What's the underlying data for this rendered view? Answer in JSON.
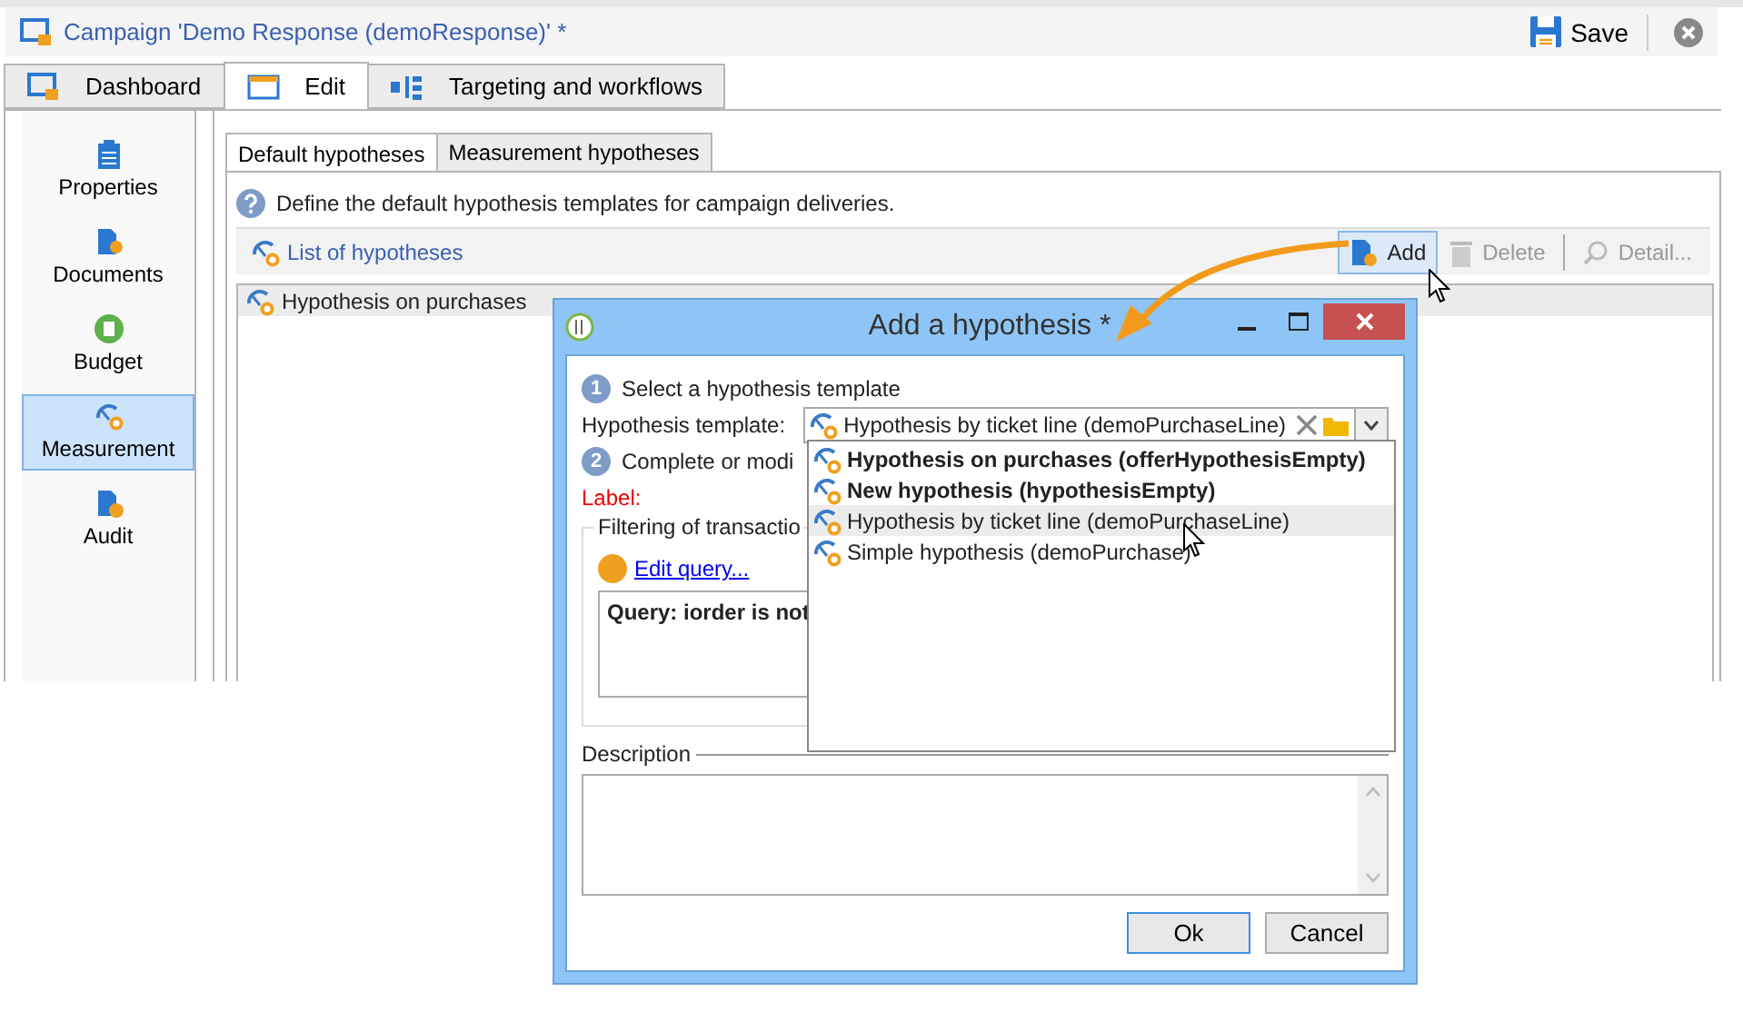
{
  "window": {
    "title": "Campaign 'Demo Response (demoResponse)' *",
    "save": "Save"
  },
  "tabs": [
    {
      "label": "Dashboard",
      "kind": "dashboard",
      "selected": false
    },
    {
      "label": "Edit",
      "kind": "edit",
      "selected": true
    },
    {
      "label": "Targeting and workflows",
      "kind": "workflow",
      "selected": false
    }
  ],
  "sidebar": {
    "items": [
      {
        "label": "Properties",
        "kind": "clipboard",
        "selected": false
      },
      {
        "label": "Documents",
        "kind": "document",
        "selected": false
      },
      {
        "label": "Budget",
        "kind": "budget",
        "selected": false
      },
      {
        "label": "Measurement",
        "kind": "gauge",
        "selected": true
      },
      {
        "label": "Audit",
        "kind": "audit",
        "selected": false
      }
    ]
  },
  "subtabs": [
    {
      "label": "Default hypotheses",
      "selected": true
    },
    {
      "label": "Measurement hypotheses",
      "selected": false
    }
  ],
  "info": "Define the default hypothesis templates for campaign deliveries.",
  "toolbar": {
    "title": "List of hypotheses",
    "buttons": [
      {
        "label": "Add",
        "kind": "add",
        "disabled": false,
        "hovered": true
      },
      {
        "label": "Delete",
        "kind": "delete",
        "disabled": true,
        "hovered": false
      },
      {
        "label": "Detail...",
        "kind": "detail",
        "disabled": true,
        "hovered": false
      }
    ]
  },
  "list": {
    "rows": [
      {
        "label": "Hypothesis on purchases",
        "selected": true
      }
    ]
  },
  "dialog": {
    "title": "Add a hypothesis *",
    "step1": {
      "number": "1",
      "label": "Select a hypothesis template"
    },
    "template": {
      "label": "Hypothesis template:",
      "value": "Hypothesis by ticket line (demoPurchaseLine)"
    },
    "options": [
      {
        "label": "Hypothesis on purchases (offerHypothesisEmpty)",
        "emphasized": true,
        "selected": false
      },
      {
        "label": "New hypothesis (hypothesisEmpty)",
        "emphasized": true,
        "selected": false
      },
      {
        "label": "Hypothesis by ticket line (demoPurchaseLine)",
        "emphasized": false,
        "selected": true
      },
      {
        "label": "Simple hypothesis (demoPurchase)",
        "emphasized": false,
        "selected": false
      }
    ],
    "step2": {
      "number": "2",
      "label": "Complete or modi"
    },
    "label_field": {
      "label": "Label:",
      "required": true
    },
    "filter": {
      "legend": "Filtering of transactio",
      "link": "Edit query...",
      "query": "Query: iorder is not"
    },
    "description": {
      "label": "Description"
    },
    "buttons": [
      {
        "label": "Ok",
        "default": true
      },
      {
        "label": "Cancel",
        "default": false
      }
    ]
  }
}
